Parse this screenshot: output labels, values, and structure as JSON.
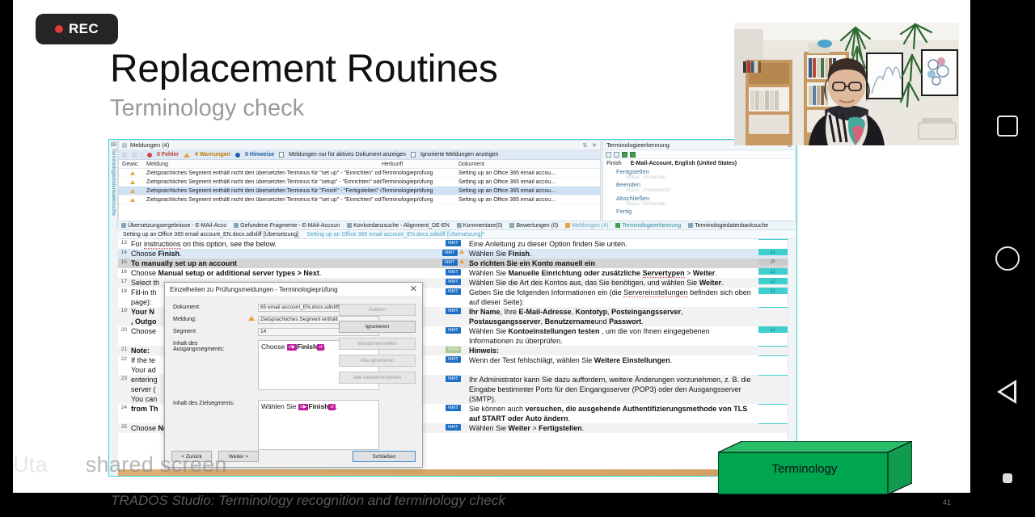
{
  "recording": {
    "label": "REC",
    "dot_color": "#e23c34"
  },
  "slide": {
    "title": "Replacement Routines",
    "subtitle": "Terminology check",
    "caption": "TRADOS Studio: Terminology recognition and terminology check",
    "page_number": "41",
    "share_watermark": "Uta ... shared screen"
  },
  "terminology_box": {
    "label": "Terminology",
    "face_color": "#00a550",
    "top_color": "#2bbd6a",
    "side_color": "#1a9f54"
  },
  "android_nav": {
    "recent_apps": "square-icon",
    "home": "circle-icon",
    "back": "triangle-back-icon",
    "indicator": "dot-icon"
  },
  "trados": {
    "vertical_dock_label": "Terminologiedatenbanksuche",
    "messages_pane": {
      "title": "Meldungen (4)",
      "toolbar": {
        "errors": "0 Fehler",
        "warnings": "4 Warnungen",
        "hints": "0 Hinweise",
        "active_doc_filter": "Meldungen nur für aktives Dokument anzeigen",
        "ignored_filter": "Ignorierte Meldungen anzeigen"
      },
      "columns": [
        "Gewic",
        "Meldung",
        "Herkunft",
        "Dokument"
      ],
      "rows": [
        {
          "severity": "warning",
          "message": "Zielsprachliches Segment enthält nicht den übersetzten Terminus für \"set up\" - \"Einrichten\" oder Synon...",
          "source": "Terminologieprüfung",
          "document": "Setting up an Office 365 email accou...",
          "selected": false
        },
        {
          "severity": "warning",
          "message": "Zielsprachliches Segment enthält nicht den übersetzten Terminus für \"setup\" - \"Einrichten\" oder Synony...",
          "source": "Terminologieprüfung",
          "document": "Setting up an Office 365 email accou...",
          "selected": false
        },
        {
          "severity": "warning",
          "message": "Zielsprachliches Segment enthält nicht den übersetzten Terminus für \"Finish\" - \"Fertigstellen\" oder Syno...",
          "source": "Terminologieprüfung",
          "document": "Setting up an Office 365 email accou...",
          "selected": true
        },
        {
          "severity": "warning",
          "message": "Zielsprachliches Segment enthält nicht den übersetzten Terminus für \"set up\" - \"Einrichten\" oder Synon...",
          "source": "Terminologieprüfung",
          "document": "Setting up an Office 365 email accou...",
          "selected": false
        }
      ]
    },
    "term_pane": {
      "title": "Terminologieerkennung",
      "head_term": "Finish",
      "head_db": "E-Mail-Account, English  (United States)",
      "entries": [
        {
          "term": "Fertigstellen",
          "note": "Status: Vorhanden"
        },
        {
          "term": "Beenden",
          "note": "Status: Unerwünscht"
        },
        {
          "term": "Abschließen",
          "note": "Status: Vorhanden"
        },
        {
          "term": "Fertig",
          "note": ""
        }
      ]
    },
    "tab_strip": [
      {
        "label": "Übersetzungsergebnisse - E-MAil-Acco",
        "state": "normal"
      },
      {
        "label": "Gefundene Fragmente - E-MAil-Accoun",
        "state": "normal"
      },
      {
        "label": "Konkordanzsuche - Alignment_DE-EN",
        "state": "normal"
      },
      {
        "label": "Kommentare(0)",
        "state": "normal"
      },
      {
        "label": "Bewertungen (0)",
        "state": "normal"
      },
      {
        "label": "Meldungen (4)",
        "state": "warn"
      },
      {
        "label": "Terminologieerkennung",
        "state": "active"
      },
      {
        "label": "Terminologiedatenbanksuche",
        "state": "normal"
      }
    ],
    "doc_tabs": [
      {
        "label": "Setting up an Office 365 email account_EN.docx.sdlxliff [Übersetzung]",
        "active": true
      },
      {
        "label": "Setting up an Office 365 email account_EN.docx.sdlxliff [Übersetzung]*",
        "active": false
      }
    ],
    "segments": [
      {
        "num": "13",
        "source_html": "For <span class=\"spell\">instructions</span> on this option, see the below.",
        "match": "NMT",
        "match_type": "nmt",
        "warn": false,
        "target_html": "Eine Anleitung zu dieser Option finden Sie unten.",
        "status": "",
        "row": "a"
      },
      {
        "num": "14",
        "source_html": "Choose <b>Finish</b>.",
        "match": "NMT",
        "match_type": "nmt",
        "warn": true,
        "target_html": "Wählen Sie <b>Finish</b>.",
        "status": "LI",
        "row": "sel"
      },
      {
        "num": "15",
        "source_html": "<b>To manually set up an account</b>",
        "match": "NMT",
        "match_type": "nmt",
        "warn": true,
        "target_html": "<b>So richten Sie ein Konto manuell ein</b>",
        "status": "P",
        "row": "grey"
      },
      {
        "num": "16",
        "source_html": "Choose <b>Manual setup or additional server types &gt; Next</b>.",
        "match": "NMT",
        "match_type": "nmt",
        "warn": false,
        "target_html": "Wählen Sie <b>Manuelle Einrichtung oder zusätzliche <span class=\"spell\">Servertypen</span></b> &gt; <b>Weiter</b>.",
        "status": "LI",
        "row": "a"
      },
      {
        "num": "17",
        "source_html": "Select th",
        "match": "NMT",
        "match_type": "nmt",
        "warn": false,
        "target_html": "Wählen Sie die Art des Kontos aus, das Sie benötigen, und wählen Sie <b>Weiter</b>.",
        "status": "LI",
        "row": "b"
      },
      {
        "num": "18",
        "source_html": "Fill-in th<br>page):",
        "match": "NMT",
        "match_type": "nmt",
        "warn": false,
        "target_html": "Geben Sie die folgenden Informationen ein (die <span class=\"spell\">Servereinstellungen</span> befinden sich oben auf dieser Seite):",
        "status": "LI",
        "row": "a"
      },
      {
        "num": "19",
        "source_html": "<b>Your N</b><br><b>, Outgo</b>",
        "match": "NMT",
        "match_type": "nmt",
        "warn": false,
        "target_html": "<b>Ihr Name</b>, Ihre <b>E-Mail-Adresse</b>, <b>Kontotyp</b>, <b>Posteingangsserver</b>, <b>Postausgangsserver</b>, <b>Benutzername</b>und <b>Passwort</b>.",
        "status": "",
        "row": "b"
      },
      {
        "num": "20",
        "source_html": "Choose",
        "match": "NMT",
        "match_type": "nmt",
        "warn": false,
        "target_html": "Wählen Sie <b>Kontoeinstellungen testen</b> , um die von Ihnen eingegebenen Informationen zu überprüfen.",
        "status": "LI",
        "row": "a"
      },
      {
        "num": "21",
        "source_html": "<b>Note:</b>",
        "match": "100%",
        "match_type": "pct",
        "warn": false,
        "target_html": "<b>Hinweis:</b>",
        "status": "",
        "row": "b"
      },
      {
        "num": "22",
        "source_html": "If the te<br>Your ad",
        "match": "NMT",
        "match_type": "nmt",
        "warn": false,
        "target_html": "Wenn der Test fehlschlägt, wählen Sie <b>Weitere Einstellungen</b>.",
        "status": "",
        "row": "a"
      },
      {
        "num": "23",
        "source_html": "entering<br>server (<br>You can",
        "match": "NMT",
        "match_type": "nmt",
        "warn": false,
        "target_html": "Ihr Administrator kann Sie dazu auffordern, weitere Änderungen vorzunehmen, z. B. die Eingabe bestimmter Ports für den Eingangsserver (POP3) oder den Ausgangsserver (SMTP).",
        "status": "",
        "row": "b"
      },
      {
        "num": "24",
        "source_html": "<b>from Th</b>",
        "match": "NMT",
        "match_type": "nmt",
        "warn": false,
        "target_html": "Sie können auch <b>versuchen, die ausgehende Authentifizierungsmethode von TLS auf START oder Auto</b> <b>ändern</b>.",
        "status": "",
        "row": "a"
      },
      {
        "num": "25",
        "source_html": "Choose <b>Next &gt; Finish</b>.",
        "match": "NMT",
        "match_type": "nmt",
        "warn": false,
        "target_html": "Wählen Sie <b>Weiter</b> &gt; <b>Fertigstellen</b>.",
        "status": "",
        "row": "b"
      }
    ],
    "dialog": {
      "title": "Einzelheiten zu Prüfungsmeldungen - Terminologieprüfung",
      "close_glyph": "✕",
      "fields": {
        "document_label": "Dokument:",
        "document_value": "65 email account_EN.docx.sdlxliff",
        "message_label": "Meldung:",
        "message_value": "Zielsprachliches Segment enthält",
        "segment_label": "Segment",
        "segment_value": "14",
        "source_label": "Inhalt des Ausgangssegments:",
        "target_label": "Inhalt des Zielsegments:"
      },
      "source_content": {
        "pre": "Choose ",
        "tag1": "cf",
        "mid": "Finish",
        "tag2": "cf",
        "post": "."
      },
      "target_content": {
        "pre": "Wählen Sie ",
        "tag1": "cf",
        "mid": "Finish",
        "tag2": "cf",
        "post": "."
      },
      "side_buttons": [
        {
          "label": "Ändern",
          "enabled": false
        },
        {
          "label": "Ignorieren",
          "enabled": true
        },
        {
          "label": "Wiederherstellen",
          "enabled": false
        },
        {
          "label": "Alle ignorieren",
          "enabled": false
        },
        {
          "label": "Alle wiederherstellen",
          "enabled": false
        }
      ],
      "footer_buttons": {
        "back": "< Zurück",
        "next": "Weiter >",
        "close": "Schließen"
      }
    }
  }
}
